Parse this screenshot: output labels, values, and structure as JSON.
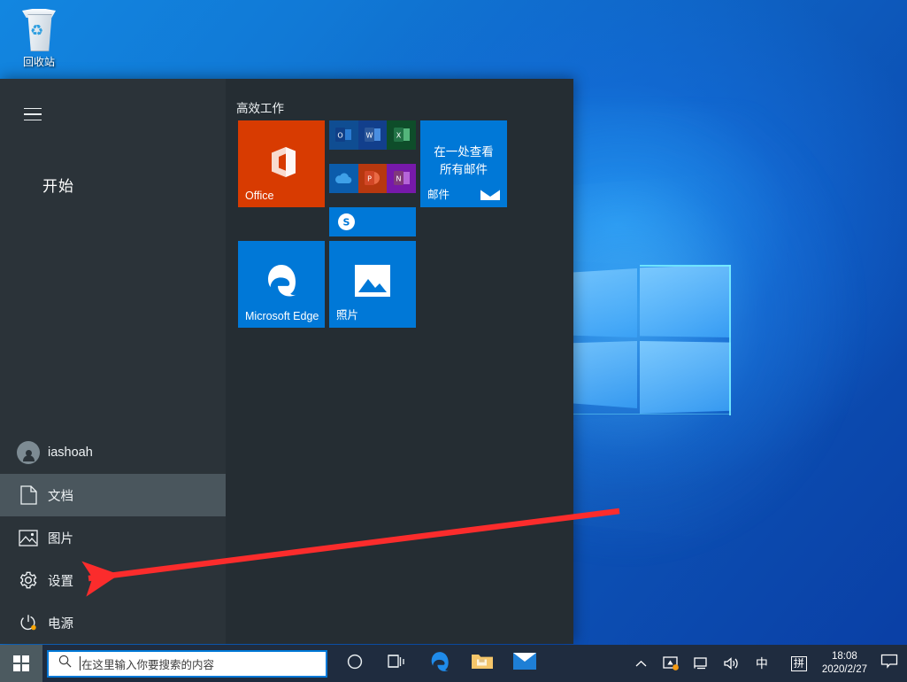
{
  "desktop": {
    "recycle_bin_label": "回收站",
    "recycle_bin_icon": "recycle-bin-icon",
    "wallpaper": "windows-10-hero-blue"
  },
  "start_menu": {
    "hamburger_icon": "hamburger-menu-icon",
    "start_label": "开始",
    "rail_items": [
      {
        "label": "iashoah",
        "icon": "user-avatar-icon",
        "selected": false
      },
      {
        "label": "文档",
        "icon": "document-icon",
        "selected": true
      },
      {
        "label": "图片",
        "icon": "picture-icon",
        "selected": false
      },
      {
        "label": "设置",
        "icon": "gear-icon",
        "selected": false
      },
      {
        "label": "电源",
        "icon": "power-icon",
        "selected": false
      }
    ],
    "group_title": "高效工作",
    "tiles": {
      "office": {
        "label": "Office",
        "icon": "office-logo-icon",
        "color": "#d83b01"
      },
      "mail": {
        "headline": "在一处查看所有邮件",
        "label": "邮件",
        "icon": "envelope-icon",
        "color": "#0078d7"
      },
      "edge": {
        "label": "Microsoft Edge",
        "icon": "edge-logo-icon",
        "color": "#0078d7"
      },
      "photos": {
        "label": "照片",
        "icon": "photos-icon",
        "color": "#0078d7"
      },
      "mini_apps": [
        {
          "name": "Outlook",
          "glyph": "O",
          "color": "#0f4d92",
          "badge": "#1a6fc4"
        },
        {
          "name": "Word",
          "glyph": "W",
          "color": "#123f8c",
          "badge": "#2b579a"
        },
        {
          "name": "Excel",
          "glyph": "X",
          "color": "#0e4d2a",
          "badge": "#217346"
        },
        {
          "name": "OneDrive",
          "glyph": "☁",
          "color": "#0b5cab",
          "badge": "#0f7ec7"
        },
        {
          "name": "PowerPoint",
          "glyph": "P",
          "color": "#b7380f",
          "badge": "#d24726"
        },
        {
          "name": "OneNote",
          "glyph": "N",
          "color": "#7719aa",
          "badge": "#9b31c9"
        }
      ],
      "skype": {
        "name": "Skype",
        "glyph": "S",
        "color": "#0078d7"
      }
    }
  },
  "annotation": {
    "arrow_color": "#fb2c2c",
    "arrow_target": "设置"
  },
  "taskbar": {
    "start_button_icon": "windows-logo-icon",
    "search": {
      "placeholder": "在这里输入你要搜索的内容",
      "value": "",
      "icon": "search-icon"
    },
    "buttons": [
      {
        "name": "cortana",
        "icon": "cortana-circle-icon"
      },
      {
        "name": "task-view",
        "icon": "task-view-icon"
      },
      {
        "name": "edge",
        "icon": "edge-logo-icon"
      },
      {
        "name": "file-explorer",
        "icon": "folder-icon"
      },
      {
        "name": "mail",
        "icon": "envelope-icon"
      }
    ],
    "tray": [
      {
        "name": "show-hidden-icons",
        "glyph": "^"
      },
      {
        "name": "security-shield-icon",
        "glyph": ""
      },
      {
        "name": "network-icon",
        "glyph": ""
      },
      {
        "name": "volume-icon",
        "glyph": ""
      },
      {
        "name": "ime-language-icon",
        "glyph": "中"
      },
      {
        "name": "ime-pinyin-icon",
        "glyph": "拼"
      }
    ],
    "clock": {
      "time": "18:08",
      "date": "2020/2/27"
    },
    "notifications_icon": "notification-bubble-icon"
  }
}
